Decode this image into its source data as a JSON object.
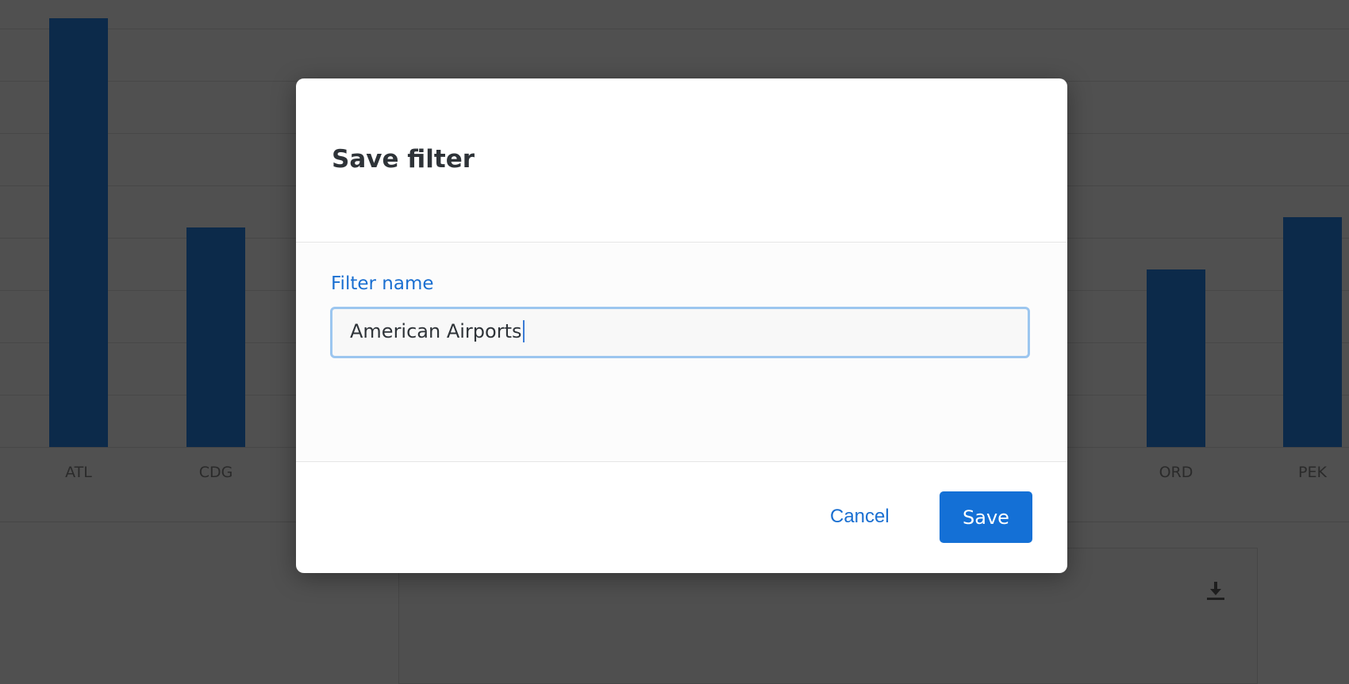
{
  "chart_data": {
    "type": "bar",
    "categories": [
      "ATL",
      "CDG",
      "ORD",
      "PEK"
    ],
    "values": [
      8.2,
      4.2,
      3.4,
      4.4
    ],
    "ylim": [
      0,
      8.5
    ],
    "grid": true,
    "bar_color": "#0c2a4a"
  },
  "dialog": {
    "title": "Save filter",
    "field_label": "Filter name",
    "field_value": "American Airports",
    "cancel_label": "Cancel",
    "save_label": "Save",
    "accent_color": "#1470d6"
  },
  "icons": {
    "download": "download-icon"
  }
}
